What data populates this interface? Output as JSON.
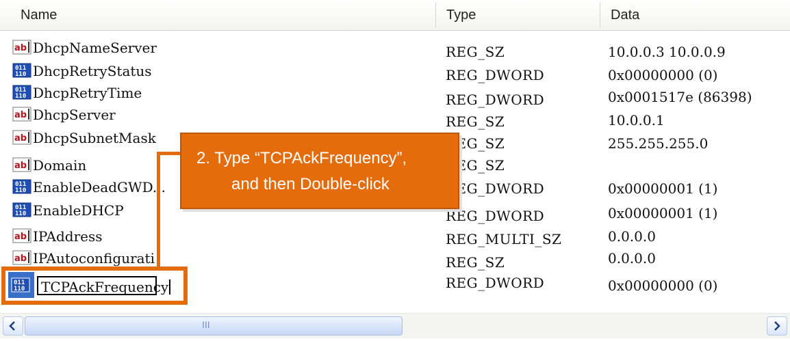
{
  "columns": {
    "name": "Name",
    "type": "Type",
    "data": "Data"
  },
  "rows": [
    {
      "icon": "string-value-icon",
      "name": "DhcpNameServer",
      "type": "REG_SZ",
      "data": "10.0.0.3 10.0.0.9"
    },
    {
      "icon": "binary-value-icon",
      "name": "DhcpRetryStatus",
      "type": "REG_DWORD",
      "data": "0x00000000 (0)"
    },
    {
      "icon": "binary-value-icon",
      "name": "DhcpRetryTime",
      "type": "REG_DWORD",
      "data": "0x0001517e (86398)"
    },
    {
      "icon": "string-value-icon",
      "name": "DhcpServer",
      "type": "REG_SZ",
      "data": "10.0.0.1"
    },
    {
      "icon": "string-value-icon",
      "name": "DhcpSubnetMask",
      "type": "REG_SZ",
      "data": "255.255.255.0"
    },
    {
      "icon": "string-value-icon",
      "name": "Domain",
      "type": "REG_SZ",
      "data": ""
    },
    {
      "icon": "binary-value-icon",
      "name": "EnableDeadGWD...",
      "type": "REG_DWORD",
      "data": "0x00000001 (1)"
    },
    {
      "icon": "binary-value-icon",
      "name": "EnableDHCP",
      "type": "REG_DWORD",
      "data": "0x00000001 (1)"
    },
    {
      "icon": "string-value-icon",
      "name": "IPAddress",
      "type": "REG_MULTI_SZ",
      "data": "0.0.0.0"
    },
    {
      "icon": "string-value-icon",
      "name": "IPAutoconfigurati",
      "type": "REG_SZ",
      "data": "0.0.0.0"
    }
  ],
  "new_entry": {
    "icon": "binary-value-icon",
    "name": "TCPAckFrequency",
    "type": "REG_DWORD",
    "data": "0x00000000 (0)"
  },
  "callout": {
    "line1": "2.  Type “TCPAckFrequency”,",
    "line2": "and then Double-click"
  },
  "scrollbar": {
    "grip": "III"
  },
  "colors": {
    "accent": "#e46c0a",
    "string_icon": "#b5121b",
    "binary_icon": "#1f4fb3"
  }
}
